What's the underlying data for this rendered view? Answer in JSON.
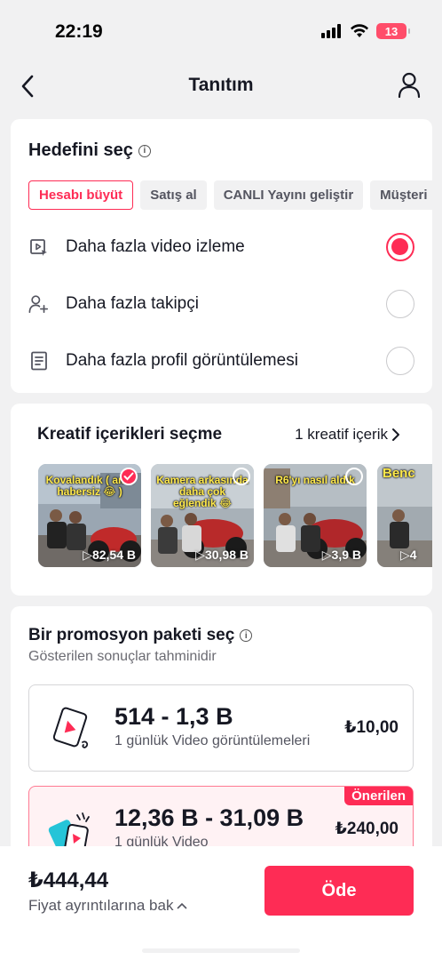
{
  "status_bar": {
    "time": "22:19",
    "battery": "13",
    "icons": [
      "signal-icon",
      "wifi-icon",
      "battery-icon"
    ]
  },
  "header": {
    "title": "Tanıtım",
    "back_icon": "chevron-left-icon",
    "profile_icon": "person-icon"
  },
  "goal": {
    "title": "Hedefini seç",
    "chips": [
      {
        "label": "Hesabı büyüt",
        "active": true
      },
      {
        "label": "Satış al",
        "active": false
      },
      {
        "label": "CANLI Yayını geliştir",
        "active": false
      },
      {
        "label": "Müşteri",
        "active": false
      }
    ],
    "options": [
      {
        "label": "Daha fazla video izleme",
        "icon": "video-play-icon",
        "selected": true
      },
      {
        "label": "Daha fazla takipçi",
        "icon": "add-user-icon",
        "selected": false
      },
      {
        "label": "Daha fazla profil görüntülemesi",
        "icon": "document-icon",
        "selected": false
      }
    ]
  },
  "creative": {
    "title": "Kreatif içerikleri seçme",
    "count_label": "1 kreatif içerik",
    "thumbnails": [
      {
        "caption": "Kovalandık ( ama habersiz 😂 )",
        "views": "▷82,54 B",
        "checked": true
      },
      {
        "caption": "Kamera arkasında daha çok eğlendik 😂",
        "views": "▷30,98 B",
        "checked": false
      },
      {
        "caption": "R6'yı nasıl aldık",
        "views": "▷3,9 B",
        "checked": false
      },
      {
        "caption": "Benc",
        "views": "▷4",
        "checked": false
      }
    ]
  },
  "package": {
    "title": "Bir promosyon paketi seç",
    "subtitle": "Gösterilen sonuçlar tahminidir",
    "items": [
      {
        "range": "514 - 1,3 B",
        "desc": "1 günlük Video görüntülemeleri",
        "price": "₺10,00",
        "badge": ""
      },
      {
        "range": "12,36 B - 31,09 B",
        "desc": "1 günlük Video",
        "price": "₺240,00",
        "badge": "Önerilen"
      }
    ]
  },
  "footer": {
    "total": "₺444,44",
    "details": "Fiyat ayrıntılarına bak",
    "pay_label": "Öde"
  },
  "colors": {
    "accent": "#fe2c55",
    "background": "#f1f1f2",
    "card": "#ffffff"
  }
}
